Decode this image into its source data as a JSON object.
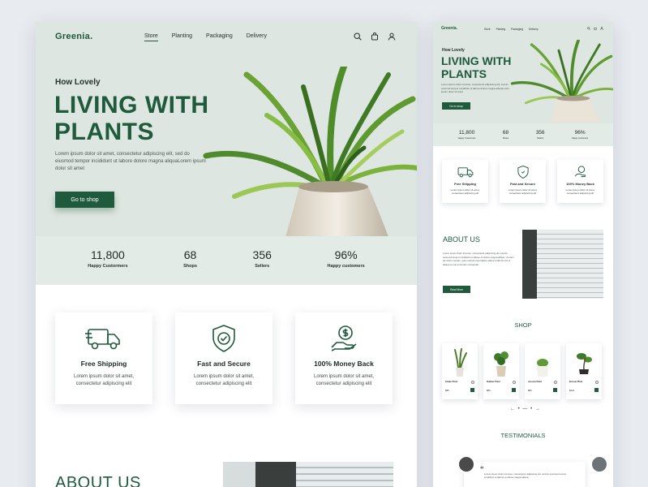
{
  "brand": {
    "logo": "Greenia."
  },
  "nav": {
    "items": [
      "Store",
      "Planting",
      "Packaging",
      "Delivery"
    ],
    "active": "Store"
  },
  "hero": {
    "eyebrow": "How Lovely",
    "title_line1": "LIVING WITH",
    "title_line2": "PLANTS",
    "lede": "Lorem ipsum dolor sit amet, consectetur adipiscing elit, sed do eiusmod tempor incididunt ut labore dolore magna aliquaLorem ipsum dolor sit amet",
    "cta": "Go to shop"
  },
  "stats": [
    {
      "value": "11,800",
      "label": "Happy Custormers"
    },
    {
      "value": "68",
      "label": "Shops"
    },
    {
      "value": "356",
      "label": "Sellers"
    },
    {
      "value": "96%",
      "label": "Happy customers"
    }
  ],
  "features": [
    {
      "title": "Free Shipping",
      "desc": "Lorem ipsum dolor sit amet, consectetur adipiscing elit",
      "icon": "truck-icon"
    },
    {
      "title": "Fast and Secure",
      "desc": "Lorem ipsum dolor sit amet, consectetur adipiscing elit",
      "icon": "shield-icon"
    },
    {
      "title": "100% Money Back",
      "desc": "Lorem ipsum dolor sit amet, consectetur adipiscing elit",
      "icon": "money-hand-icon"
    }
  ],
  "about": {
    "title": "ABOUT US",
    "text": "Lorem ipsum dolor sit amet, consectetur adipiscing elit, sed do eiusmod tempor incididunt ut labore et dolore magna aliqua. Ut enim ad minim veniam, quis nostrud exercitation ullamco laboris nisi ut aliquip ex ea commodo consequat.",
    "button": "Read More"
  },
  "shop": {
    "title": "SHOP",
    "products": [
      {
        "name": "Snake Plant",
        "price": "$85"
      },
      {
        "name": "Rubber Plant",
        "price": "$80"
      },
      {
        "name": "Jessica Plant",
        "price": "$85"
      },
      {
        "name": "Bonsai Plant",
        "price": "$210"
      }
    ],
    "pager": "← • — • →"
  },
  "testimonials": {
    "title": "TESTIMONIALS",
    "quote_mark": "“",
    "text": "Lorem ipsum dolor sit amet, consectetur adipiscing elit, sed do eiusmod tempor incididunt ut labore et dolore magna aliqua."
  },
  "colors": {
    "accent": "#1f5a3c",
    "hero_bg": "#dde6e0",
    "stats_bg": "#e3ebe6"
  }
}
